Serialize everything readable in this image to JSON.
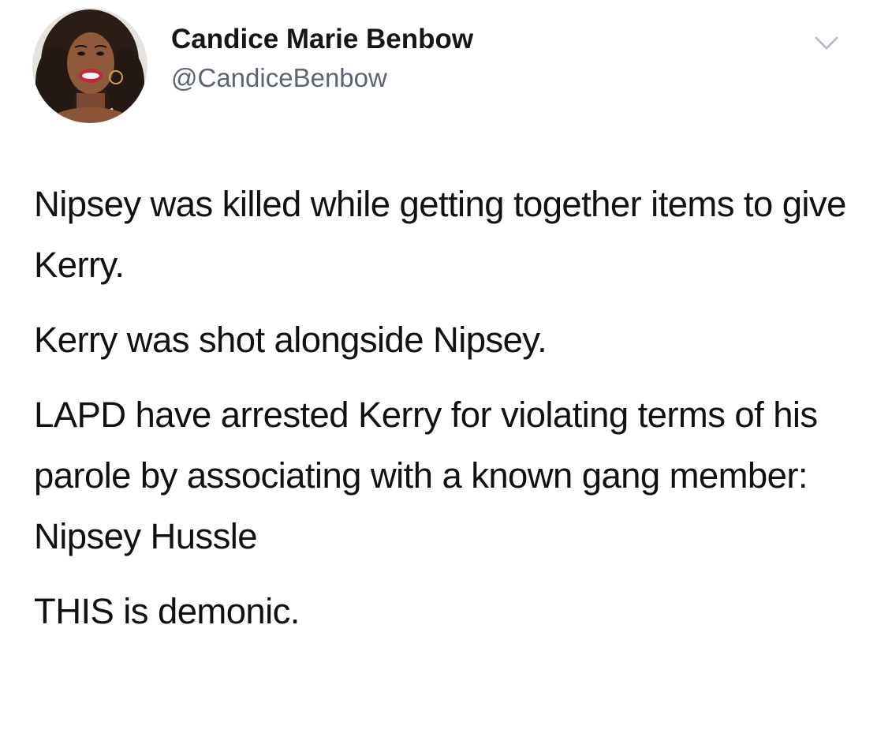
{
  "tweet": {
    "author": {
      "display_name": "Candice Marie Benbow",
      "handle": "@CandiceBenbow"
    },
    "menu_icon": "chevron-down-icon",
    "paragraphs": [
      "Nipsey was killed while getting together items to give Kerry.",
      "Kerry was shot alongside Nipsey.",
      "LAPD have arrested Kerry for violating terms of his parole by associating with a known gang member: Nipsey Hussle",
      "THIS is demonic."
    ]
  },
  "colors": {
    "background": "#ffffff",
    "text": "#14171a",
    "handle": "#5b6670",
    "caret": "#aab8c2"
  }
}
